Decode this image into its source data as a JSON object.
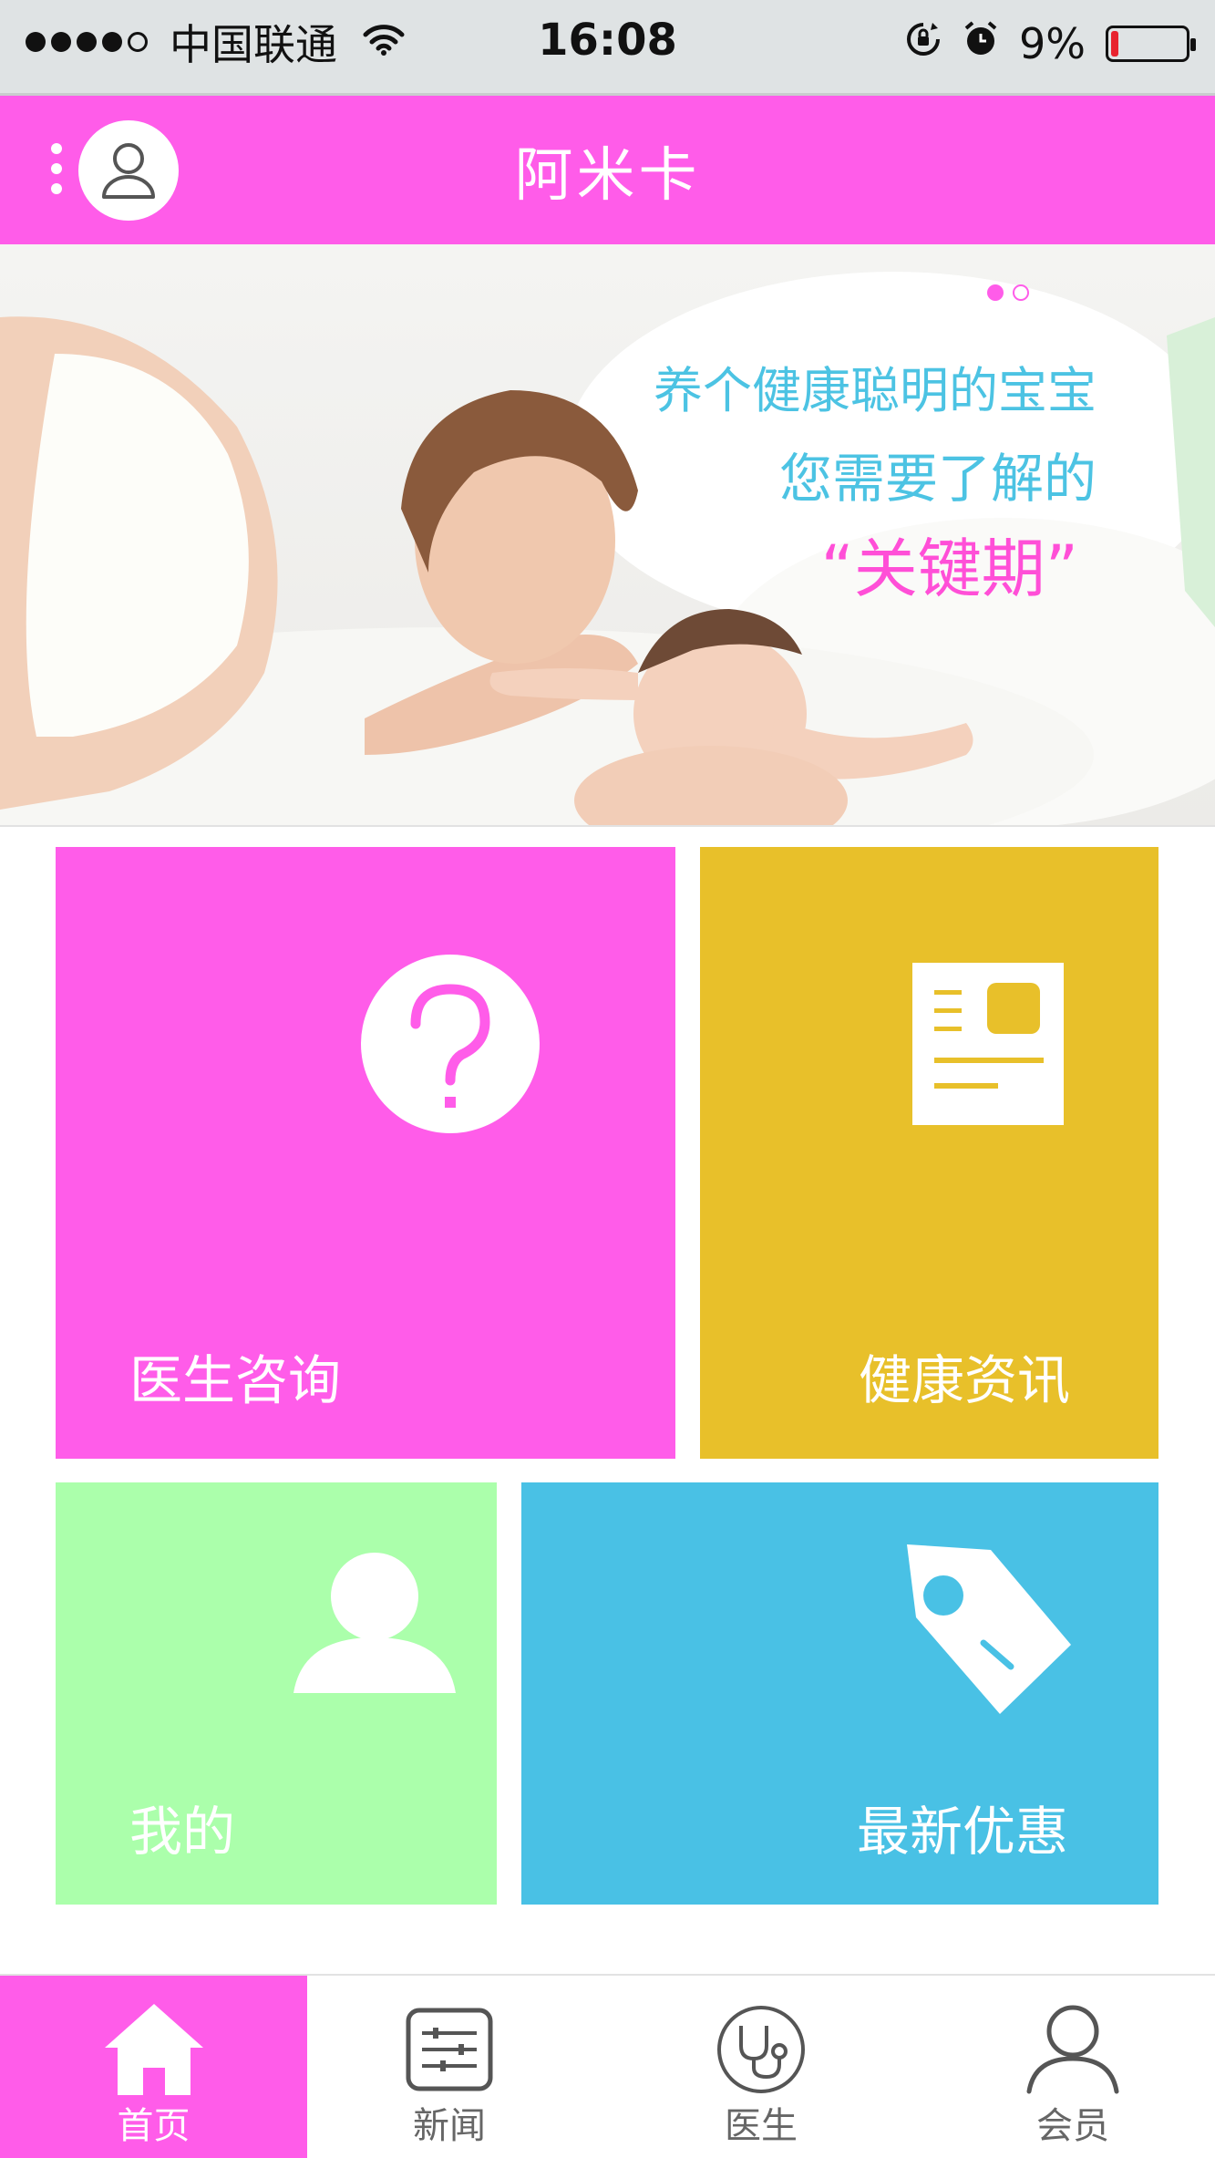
{
  "status_bar": {
    "carrier": "中国联通",
    "time": "16:08",
    "battery": "9%",
    "battery_level": 0.09
  },
  "header": {
    "title": "阿米卡"
  },
  "banner": {
    "line1": "养个健康聪明的宝宝",
    "line2": "您需要了解的",
    "line3": "“关键期”"
  },
  "tiles": {
    "consult": "医生咨询",
    "news": "健康资讯",
    "mine": "我的",
    "deals": "最新优惠"
  },
  "tabs": [
    {
      "label": "首页",
      "icon": "home-icon"
    },
    {
      "label": "新闻",
      "icon": "news-sliders-icon"
    },
    {
      "label": "医生",
      "icon": "stethoscope-icon"
    },
    {
      "label": "会员",
      "icon": "member-icon"
    }
  ],
  "colors": {
    "primary": "#ff5ce9",
    "yellow": "#e8c02a",
    "green": "#abffab",
    "blue": "#49c1e5"
  }
}
